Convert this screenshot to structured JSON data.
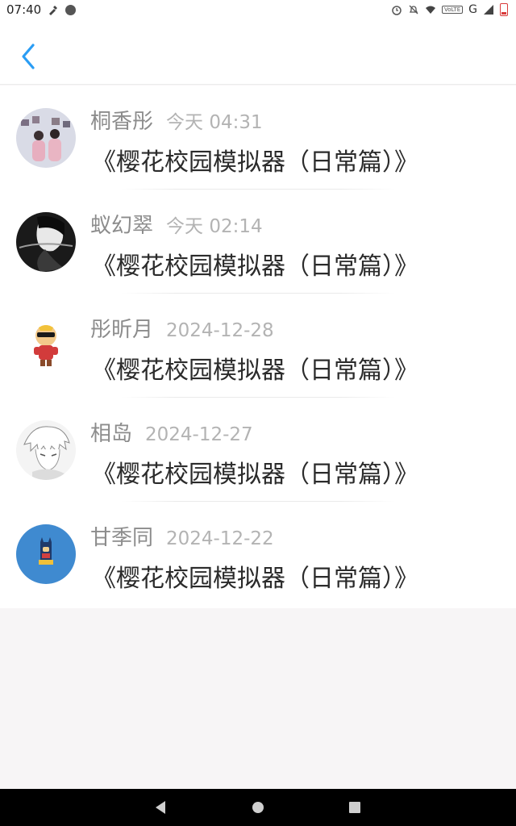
{
  "status_bar": {
    "time": "07:40",
    "network_type": "G",
    "lte_label": "VoLTE"
  },
  "header": {
    "back_icon": "chevron-left-icon",
    "accent_color": "#2a9df4"
  },
  "messages": [
    {
      "name": "桐香彤",
      "time": "今天 04:31",
      "text": "《樱花校园模拟器（日常篇）》",
      "avatar": "couple-photo-avatar"
    },
    {
      "name": "蚁幻翠",
      "time": "今天 02:14",
      "text": "《樱花校园模拟器（日常篇）》",
      "avatar": "dark-portrait-avatar"
    },
    {
      "name": "彤昕月",
      "time": "2024-12-28",
      "text": "《樱花校园模拟器（日常篇）》",
      "avatar": "cartoon-character-avatar"
    },
    {
      "name": "相岛",
      "time": "2024-12-27",
      "text": "《樱花校园模拟器（日常篇）》",
      "avatar": "anime-sketch-avatar"
    },
    {
      "name": "甘季同",
      "time": "2024-12-22",
      "text": "《樱花校园模拟器（日常篇）》",
      "avatar": "blue-hero-avatar"
    }
  ],
  "nav_bar": {
    "back_icon": "triangle-back-icon",
    "home_icon": "circle-home-icon",
    "recents_icon": "square-recents-icon"
  }
}
